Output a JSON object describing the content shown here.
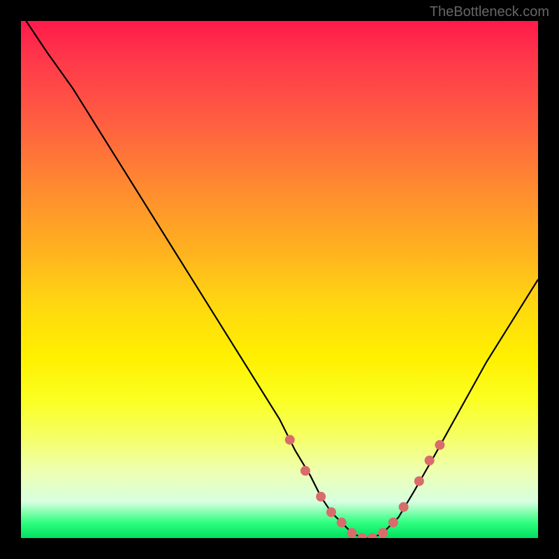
{
  "watermark": "TheBottleneck.com",
  "chart_data": {
    "type": "line",
    "title": "",
    "xlabel": "",
    "ylabel": "",
    "xlim": [
      0,
      100
    ],
    "ylim": [
      0,
      100
    ],
    "series": [
      {
        "name": "bottleneck-curve",
        "x": [
          1,
          5,
          10,
          15,
          20,
          25,
          30,
          35,
          40,
          45,
          50,
          53,
          56,
          58,
          60,
          62,
          64,
          66,
          68,
          70,
          73,
          76,
          80,
          85,
          90,
          95,
          100
        ],
        "y": [
          100,
          94,
          87,
          79,
          71,
          63,
          55,
          47,
          39,
          31,
          23,
          17,
          12,
          8,
          5,
          3,
          1,
          0,
          0,
          1,
          4,
          9,
          16,
          25,
          34,
          42,
          50
        ]
      }
    ],
    "markers": {
      "name": "highlight-points",
      "color": "#d96b6b",
      "x": [
        52,
        55,
        58,
        60,
        62,
        64,
        66,
        68,
        70,
        72,
        74,
        77,
        79,
        81
      ],
      "y": [
        19,
        13,
        8,
        5,
        3,
        1,
        0,
        0,
        1,
        3,
        6,
        11,
        15,
        18
      ]
    }
  }
}
